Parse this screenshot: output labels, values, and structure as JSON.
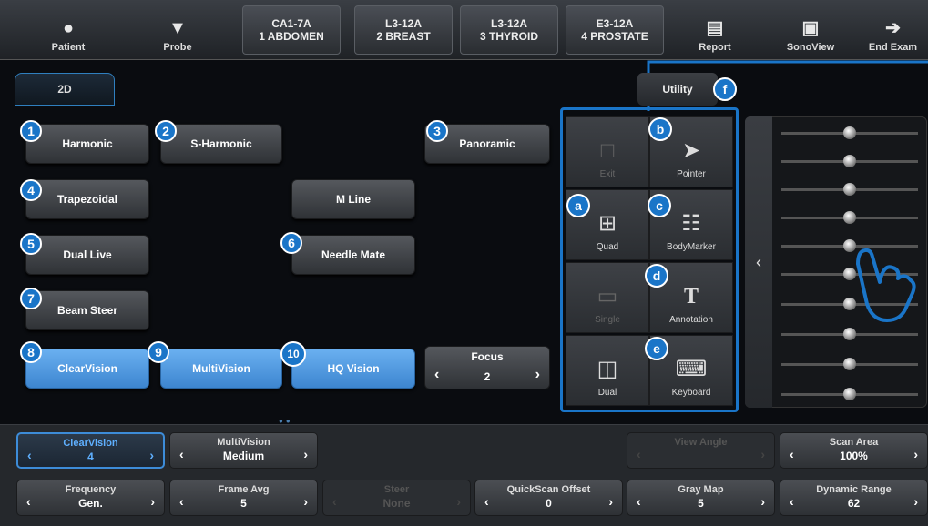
{
  "topbar": {
    "patient": "Patient",
    "probe": "Probe",
    "presets": [
      {
        "l1": "CA1-7A",
        "l2": "1 ABDOMEN"
      },
      {
        "l1": "L3-12A",
        "l2": "2 BREAST"
      },
      {
        "l1": "L3-12A",
        "l2": "3 THYROID"
      },
      {
        "l1": "E3-12A",
        "l2": "4 PROSTATE"
      }
    ],
    "report": "Report",
    "sonoview": "SonoView",
    "end_exam": "End Exam"
  },
  "mode_tab": "2D",
  "utility_tab": "Utility",
  "callouts": {
    "f": "f",
    "a": "a",
    "b": "b",
    "c": "c",
    "d": "d",
    "e": "e"
  },
  "buttons": {
    "harmonic": {
      "num": "1",
      "label": "Harmonic"
    },
    "s_harmonic": {
      "num": "2",
      "label": "S-Harmonic"
    },
    "panoramic": {
      "num": "3",
      "label": "Panoramic"
    },
    "trapezoidal": {
      "num": "4",
      "label": "Trapezoidal"
    },
    "m_line": {
      "label": "M Line"
    },
    "dual_live": {
      "num": "5",
      "label": "Dual Live"
    },
    "needle_mate": {
      "num": "6",
      "label": "Needle Mate"
    },
    "beam_steer": {
      "num": "7",
      "label": "Beam Steer"
    },
    "clearvision": {
      "num": "8",
      "label": "ClearVision"
    },
    "multivision": {
      "num": "9",
      "label": "MultiVision"
    },
    "hq_vision": {
      "num": "10",
      "label": "HQ Vision"
    }
  },
  "focus": {
    "title": "Focus",
    "value": "2"
  },
  "utility": {
    "exit": "Exit",
    "pointer": "Pointer",
    "quad": "Quad",
    "bodymarker": "BodyMarker",
    "single": "Single",
    "annotation": "Annotation",
    "dual": "Dual",
    "keyboard": "Keyboard"
  },
  "sliders": {
    "count": 10
  },
  "bottom": {
    "clearvision": {
      "title": "ClearVision",
      "value": "4"
    },
    "multivision": {
      "title": "MultiVision",
      "value": "Medium"
    },
    "view_angle": {
      "title": "View Angle",
      "value": ""
    },
    "scan_area": {
      "title": "Scan Area",
      "value": "100%"
    },
    "frequency": {
      "title": "Frequency",
      "value": "Gen."
    },
    "frame_avg": {
      "title": "Frame Avg",
      "value": "5"
    },
    "steer": {
      "title": "Steer",
      "value": "None"
    },
    "quickscan": {
      "title": "QuickScan Offset",
      "value": "0"
    },
    "gray_map": {
      "title": "Gray Map",
      "value": "5"
    },
    "dynamic_range": {
      "title": "Dynamic Range",
      "value": "62"
    }
  },
  "colors": {
    "accent": "#1a75c8",
    "active_button": "#4a94dc"
  }
}
